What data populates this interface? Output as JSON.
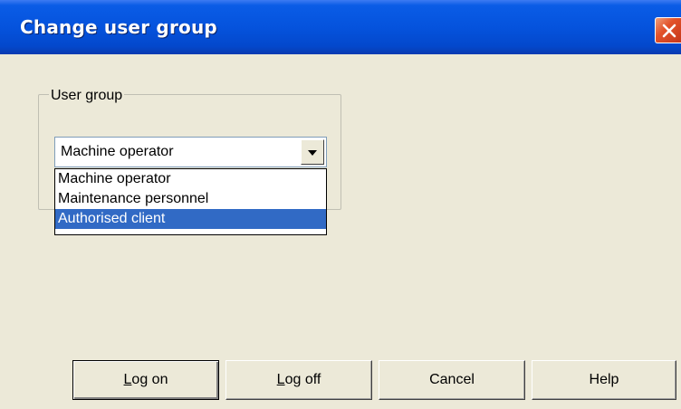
{
  "window": {
    "title": "Change user group"
  },
  "groupbox": {
    "label": "User group"
  },
  "combo": {
    "selected_value": "Machine operator",
    "options": [
      "Machine operator",
      "Maintenance personnel",
      "Authorised client"
    ],
    "highlighted_option": "Authorised client"
  },
  "buttons": {
    "logon": {
      "mnemonic": "L",
      "rest": "og on"
    },
    "logoff": {
      "mnemonic": "L",
      "rest": "og off"
    },
    "cancel": "Cancel",
    "help": "Help"
  },
  "colors": {
    "titlebar": "#0553dd",
    "selection": "#316ac5",
    "dialog_bg": "#ece9d8"
  }
}
